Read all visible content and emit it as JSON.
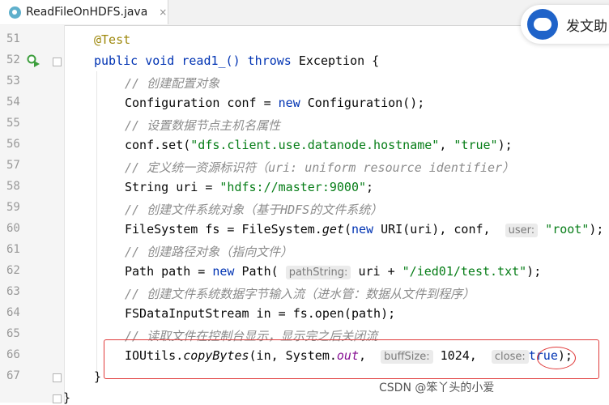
{
  "tab": {
    "title": "ReadFileOnHDFS.java",
    "close": "×"
  },
  "float_widget": {
    "text": "发文助"
  },
  "line_numbers": [
    "51",
    "52",
    "53",
    "54",
    "55",
    "56",
    "57",
    "58",
    "59",
    "60",
    "61",
    "62",
    "63",
    "64",
    "65",
    "66",
    "67"
  ],
  "code": {
    "l51": {
      "annotation": "@Test"
    },
    "l52": {
      "kw1": "public",
      "kw2": "void",
      "name": "read1_()",
      "kw3": "throws",
      "rest": "Exception {"
    },
    "l53": {
      "comment": "// 创建配置对象"
    },
    "l54": {
      "a": "Configuration conf = ",
      "kw": "new",
      "b": " Configuration();"
    },
    "l55": {
      "comment": "// 设置数据节点主机名属性"
    },
    "l56": {
      "a": "conf.set(",
      "s1": "\"dfs.client.use.datanode.hostname\"",
      "b": ", ",
      "s2": "\"true\"",
      "c": ");"
    },
    "l57": {
      "comment": "// 定义统一资源标识符（uri: uniform resource identifier）"
    },
    "l58": {
      "a": "String uri = ",
      "s": "\"hdfs://master:9000\"",
      "b": ";"
    },
    "l59": {
      "comment": "// 创建文件系统对象（基于HDFS的文件系统）"
    },
    "l60": {
      "a": "FileSystem fs = FileSystem.",
      "m": "get",
      "b": "(",
      "kw": "new",
      "c": " URI(uri), conf, ",
      "hint": "user:",
      "s": "\"root\"",
      "d": ");"
    },
    "l61": {
      "comment": "// 创建路径对象（指向文件）"
    },
    "l62": {
      "a": "Path path = ",
      "kw": "new",
      "b": " Path(",
      "hint": "pathString:",
      "c": " uri + ",
      "s": "\"/ied01/test.txt\"",
      "d": ");"
    },
    "l63": {
      "comment": "// 创建文件系统数据字节输入流（进水管：数据从文件到程序）"
    },
    "l64": {
      "text": "FSDataInputStream in = fs.open(path);"
    },
    "l65": {
      "comment": "// 读取文件在控制台显示，显示完之后关闭流"
    },
    "l66": {
      "a": "IOUtils.",
      "m": "copyBytes",
      "b": "(in, System.",
      "f": "out",
      "c": ", ",
      "hint1": "buffSize:",
      "d": " 1024, ",
      "hint2": "close:",
      "kw": "true",
      "e": ");"
    },
    "l67": {
      "text": "}"
    },
    "l68": {
      "text": "}"
    }
  },
  "watermark": "CSDN @笨丫头的小爱"
}
